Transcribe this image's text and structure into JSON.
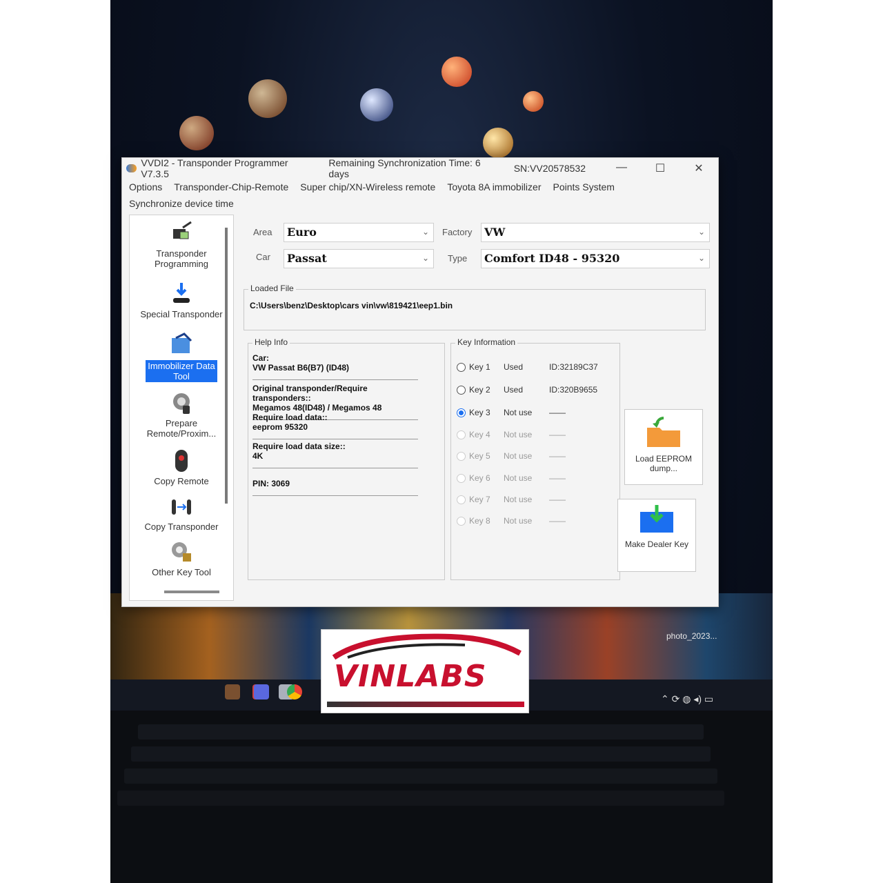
{
  "window": {
    "title": "VVDI2 - Transponder Programmer V7.3.5",
    "sync_time": "Remaining Synchronization Time: 6 days",
    "serial": "SN:VV20578532",
    "min_glyph": "—",
    "max_glyph": "☐",
    "close_glyph": "✕"
  },
  "menu": [
    "Options",
    "Transponder-Chip-Remote",
    "Super chip/XN-Wireless remote",
    "Toyota 8A immobilizer",
    "Points System",
    "Synchronize device time"
  ],
  "sidebar": [
    {
      "label": "Transponder Programming",
      "icon": "transponder-programmer-icon"
    },
    {
      "label": "Special Transponder",
      "icon": "special-transponder-icon"
    },
    {
      "label": "Immobilizer Data Tool",
      "icon": "immobilizer-icon",
      "active": true
    },
    {
      "label": "Prepare Remote/Proxim...",
      "icon": "remote-prepare-icon"
    },
    {
      "label": "Copy Remote",
      "icon": "remote-icon"
    },
    {
      "label": "Copy Transponder",
      "icon": "copy-transponder-icon"
    },
    {
      "label": "Other Key Tool",
      "icon": "key-tool-icon"
    }
  ],
  "selectors": {
    "area_label": "Area",
    "area_value": "Euro",
    "car_label": "Car",
    "car_value": "Passat",
    "factory_label": "Factory",
    "factory_value": "VW",
    "type_label": "Type",
    "type_value": "Comfort ID48 - 95320",
    "chevron": "⌄"
  },
  "loaded_file": {
    "title": "Loaded File",
    "path": "C:\\Users\\benz\\Desktop\\cars vin\\vw\\819421\\eep1.bin"
  },
  "help_info": {
    "title": "Help Info",
    "items": [
      {
        "label": "Car:",
        "value": "VW Passat B6(B7) (ID48)"
      },
      {
        "label": "Original transponder/Require transponders::",
        "value": "Megamos 48(ID48) / Megamos 48"
      },
      {
        "label": "Require load data::",
        "value": "eeprom 95320"
      },
      {
        "label": "Require load data size::",
        "value": "4K"
      },
      {
        "label": "PIN: 3069",
        "value": ""
      }
    ]
  },
  "key_information": {
    "title": "Key Information",
    "keys": [
      {
        "name": "Key 1",
        "status": "Used",
        "id": "ID:32189C37"
      },
      {
        "name": "Key 2",
        "status": "Used",
        "id": "ID:320B9655"
      },
      {
        "name": "Key 3",
        "status": "Not use",
        "id": "——",
        "selected": true
      },
      {
        "name": "Key 4",
        "status": "Not use",
        "id": "——"
      },
      {
        "name": "Key 5",
        "status": "Not use",
        "id": "——"
      },
      {
        "name": "Key 6",
        "status": "Not use",
        "id": "——"
      },
      {
        "name": "Key 7",
        "status": "Not use",
        "id": "——"
      },
      {
        "name": "Key 8",
        "status": "Not use",
        "id": "——"
      }
    ]
  },
  "actions": {
    "load_eeprom": "Load EEPROM dump...",
    "make_dealer_key": "Make Dealer Key"
  },
  "desktop": {
    "file_label": "photo_2023...",
    "brand": "VINLABS"
  },
  "colors": {
    "accent": "#1b6ff0",
    "brand_red": "#c8102e"
  }
}
